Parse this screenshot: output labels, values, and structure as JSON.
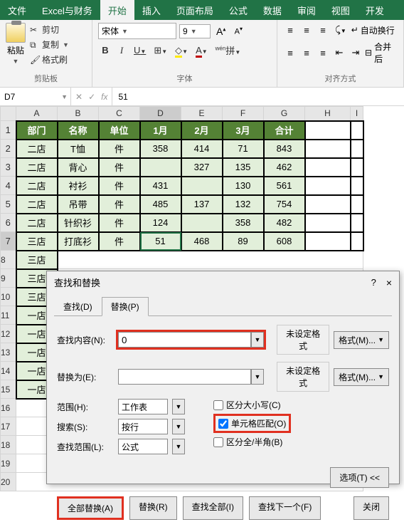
{
  "ribbon": {
    "tabs": [
      "文件",
      "Excel与财务",
      "开始",
      "插入",
      "页面布局",
      "公式",
      "数据",
      "审阅",
      "视图",
      "开发"
    ],
    "active_tab": "开始",
    "clipboard": {
      "paste": "粘贴",
      "cut": "剪切",
      "copy": "复制",
      "format_painter": "格式刷",
      "group_label": "剪贴板"
    },
    "font": {
      "name": "宋体",
      "size": "9",
      "bold": "B",
      "italic": "I",
      "underline": "U",
      "group_label": "字体",
      "inc_size": "A",
      "dec_size": "A",
      "ph": "拼"
    },
    "align": {
      "wrap": "自动换行",
      "merge": "合并后",
      "group_label": "对齐方式"
    }
  },
  "name_box": "D7",
  "fx_label": "fx",
  "formula_value": "51",
  "col_headers": [
    "A",
    "B",
    "C",
    "D",
    "E",
    "F",
    "G",
    "H",
    "I"
  ],
  "row_headers": [
    "1",
    "2",
    "3",
    "4",
    "5",
    "6",
    "7",
    "8",
    "9",
    "10",
    "11",
    "12",
    "13",
    "14",
    "15",
    "16",
    "17",
    "18",
    "19",
    "20"
  ],
  "table": {
    "header": [
      "部门",
      "名称",
      "单位",
      "1月",
      "2月",
      "3月",
      "合计"
    ],
    "rows": [
      [
        "二店",
        "T恤",
        "件",
        "358",
        "414",
        "71",
        "843"
      ],
      [
        "二店",
        "背心",
        "件",
        "",
        "327",
        "135",
        "462"
      ],
      [
        "二店",
        "衬衫",
        "件",
        "431",
        "",
        "130",
        "561"
      ],
      [
        "二店",
        "吊带",
        "件",
        "485",
        "137",
        "132",
        "754"
      ],
      [
        "二店",
        "针织衫",
        "件",
        "124",
        "",
        "358",
        "482"
      ],
      [
        "三店",
        "打底衫",
        "件",
        "51",
        "468",
        "89",
        "608"
      ]
    ],
    "col_a_rest": [
      "三店",
      "三店",
      "三店",
      "一店",
      "一店",
      "一店",
      "一店",
      "一店"
    ]
  },
  "dialog": {
    "title": "查找和替换",
    "help": "?",
    "close": "×",
    "tabs": {
      "find": "查找(D)",
      "replace": "替换(P)"
    },
    "active_tab": "replace",
    "find_label": "查找内容(N):",
    "find_value": "0",
    "replace_label": "替换为(E):",
    "replace_value": "",
    "no_format": "未设定格式",
    "format_btn": "格式(M)...",
    "scope_label": "范围(H):",
    "scope_value": "工作表",
    "search_label": "搜索(S):",
    "search_value": "按行",
    "lookin_label": "查找范围(L):",
    "lookin_value": "公式",
    "match_case": "区分大小写(C)",
    "match_entire": "单元格匹配(O)",
    "match_width": "区分全/半角(B)",
    "options_btn": "选项(T) <<",
    "btn_replace_all": "全部替换(A)",
    "btn_replace": "替换(R)",
    "btn_find_all": "查找全部(I)",
    "btn_find_next": "查找下一个(F)",
    "btn_close": "关闭"
  }
}
